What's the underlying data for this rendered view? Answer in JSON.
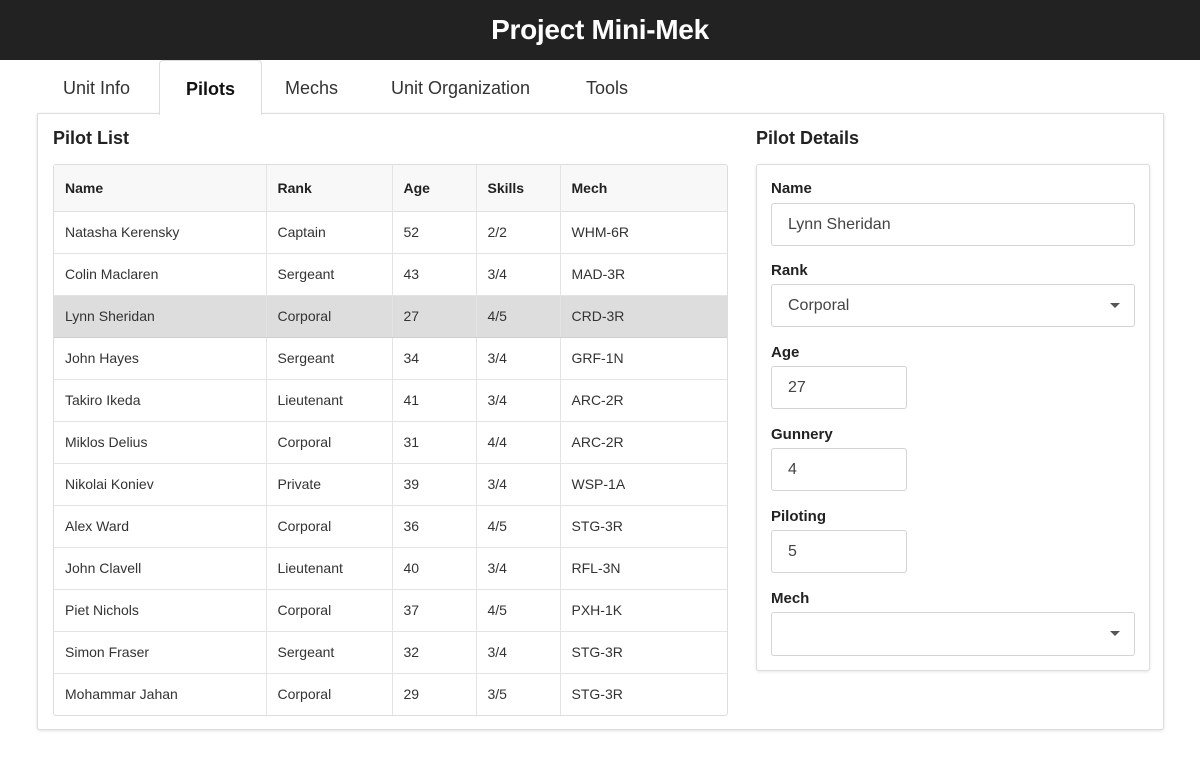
{
  "app": {
    "title": "Project Mini-Mek"
  },
  "tabs": [
    {
      "label": "Unit Info",
      "active": false
    },
    {
      "label": "Pilots",
      "active": true
    },
    {
      "label": "Mechs",
      "active": false
    },
    {
      "label": "Unit Organization",
      "active": false
    },
    {
      "label": "Tools",
      "active": false
    }
  ],
  "pilot_list": {
    "title": "Pilot List",
    "columns": [
      "Name",
      "Rank",
      "Age",
      "Skills",
      "Mech"
    ],
    "selected_index": 2,
    "rows": [
      [
        "Natasha Kerensky",
        "Captain",
        "52",
        "2/2",
        "WHM-6R"
      ],
      [
        "Colin Maclaren",
        "Sergeant",
        "43",
        "3/4",
        "MAD-3R"
      ],
      [
        "Lynn Sheridan",
        "Corporal",
        "27",
        "4/5",
        "CRD-3R"
      ],
      [
        "John Hayes",
        "Sergeant",
        "34",
        "3/4",
        "GRF-1N"
      ],
      [
        "Takiro Ikeda",
        "Lieutenant",
        "41",
        "3/4",
        "ARC-2R"
      ],
      [
        "Miklos Delius",
        "Corporal",
        "31",
        "4/4",
        "ARC-2R"
      ],
      [
        "Nikolai Koniev",
        "Private",
        "39",
        "3/4",
        "WSP-1A"
      ],
      [
        "Alex Ward",
        "Corporal",
        "36",
        "4/5",
        "STG-3R"
      ],
      [
        "John Clavell",
        "Lieutenant",
        "40",
        "3/4",
        "RFL-3N"
      ],
      [
        "Piet Nichols",
        "Corporal",
        "37",
        "4/5",
        "PXH-1K"
      ],
      [
        "Simon Fraser",
        "Sergeant",
        "32",
        "3/4",
        "STG-3R"
      ],
      [
        "Mohammar Jahan",
        "Corporal",
        "29",
        "3/5",
        "STG-3R"
      ]
    ]
  },
  "pilot_details": {
    "title": "Pilot Details",
    "name_label": "Name",
    "name_value": "Lynn Sheridan",
    "rank_label": "Rank",
    "rank_value": "Corporal",
    "age_label": "Age",
    "age_value": "27",
    "gunnery_label": "Gunnery",
    "gunnery_value": "4",
    "piloting_label": "Piloting",
    "piloting_value": "5",
    "mech_label": "Mech",
    "mech_value": ""
  }
}
